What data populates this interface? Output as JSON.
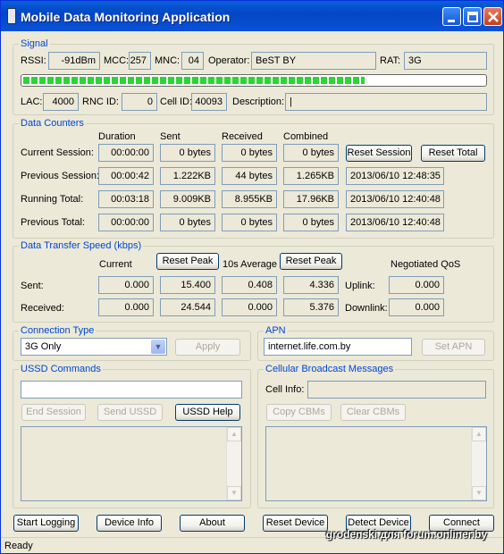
{
  "window": {
    "title": "Mobile Data Monitoring Application"
  },
  "signal": {
    "label": "Signal",
    "rssi_label": "RSSI:",
    "rssi": "-91dBm",
    "mcc_label": "MCC:",
    "mcc": "257",
    "mnc_label": "MNC:",
    "mnc": "04",
    "operator_label": "Operator:",
    "operator": "BeST BY",
    "rat_label": "RAT:",
    "rat": "3G",
    "strength_fraction": 0.74,
    "lac_label": "LAC:",
    "lac": "4000",
    "rnc_label": "RNC ID:",
    "rnc": "0",
    "cell_label": "Cell ID:",
    "cell": "40093",
    "desc_label": "Description:",
    "desc": "|"
  },
  "counters": {
    "label": "Data Counters",
    "headers": [
      "Duration",
      "Sent",
      "Received",
      "Combined"
    ],
    "rows": [
      {
        "label": "Current Session:",
        "duration": "00:00:00",
        "sent": "0 bytes",
        "received": "0 bytes",
        "combined": "0 bytes"
      },
      {
        "label": "Previous Session:",
        "duration": "00:00:42",
        "sent": "1.222KB",
        "received": "44 bytes",
        "combined": "1.265KB",
        "date": "2013/06/10 12:48:35"
      },
      {
        "label": "Running Total:",
        "duration": "00:03:18",
        "sent": "9.009KB",
        "received": "8.955KB",
        "combined": "17.96KB",
        "date": "2013/06/10 12:40:48"
      },
      {
        "label": "Previous Total:",
        "duration": "00:00:00",
        "sent": "0 bytes",
        "received": "0 bytes",
        "combined": "0 bytes",
        "date": "2013/06/10 12:40:48"
      }
    ],
    "reset_session": "Reset Session",
    "reset_total": "Reset Total"
  },
  "speed": {
    "label": "Data Transfer Speed (kbps)",
    "current_label": "Current",
    "reset_peak": "Reset Peak",
    "avg_label": "10s Average",
    "qos_label": "Negotiated QoS",
    "sent_label": "Sent:",
    "recv_label": "Received:",
    "sent": {
      "current": "0.000",
      "peak": "15.400",
      "avg": "0.408",
      "peak2": "4.336"
    },
    "recv": {
      "current": "0.000",
      "peak": "24.544",
      "avg": "0.000",
      "peak2": "5.376"
    },
    "uplink_label": "Uplink:",
    "uplink": "0.000",
    "downlink_label": "Downlink:",
    "downlink": "0.000"
  },
  "connection": {
    "label": "Connection Type",
    "value": "3G Only",
    "apply": "Apply"
  },
  "apn": {
    "label": "APN",
    "value": "internet.life.com.by",
    "set": "Set APN"
  },
  "ussd": {
    "label": "USSD Commands",
    "input": "",
    "end": "End Session",
    "send": "Send USSD",
    "help": "USSD Help"
  },
  "cbm": {
    "label": "Cellular Broadcast Messages",
    "cell_info_label": "Cell Info:",
    "cell_info": "",
    "copy": "Copy CBMs",
    "clear": "Clear CBMs"
  },
  "bottom": {
    "start_logging": "Start Logging",
    "device_info": "Device Info",
    "about": "About",
    "reset_device": "Reset Device",
    "detect_device": "Detect Device",
    "connect": "Connect"
  },
  "status": "Ready",
  "watermark": "grodenski для forum.onliner.by"
}
